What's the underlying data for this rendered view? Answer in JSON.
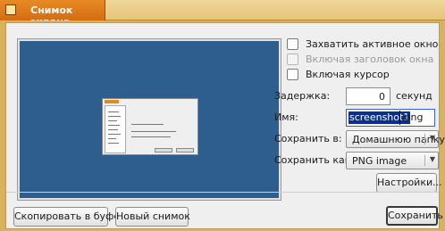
{
  "window": {
    "title": "Снимок экрана"
  },
  "options": {
    "capture_active_window": "Захватить активное окно",
    "include_title": "Включая заголовок окна",
    "include_cursor": "Включая курсор"
  },
  "fields": {
    "delay_label": "Задержка:",
    "delay_value": "0",
    "delay_unit": "секунд",
    "name_label": "Имя:",
    "name_selected": "screenshot1",
    "name_rest": ".png",
    "save_in_label": "Сохранить в:",
    "save_in_value": "Домашнюю папку",
    "save_as_label": "Сохранить как:",
    "save_as_value": "PNG image"
  },
  "buttons": {
    "settings": "Настройки...",
    "copy_to_buffer": "Скопировать в буфер",
    "new_snapshot": "Новый снимок",
    "save": "Сохранить"
  },
  "colors": {
    "desktop_bg": "#d9b25c",
    "tab_accent": "#e07f1c",
    "preview_bg": "#2e5e8e",
    "selection": "#0b2f8f"
  }
}
